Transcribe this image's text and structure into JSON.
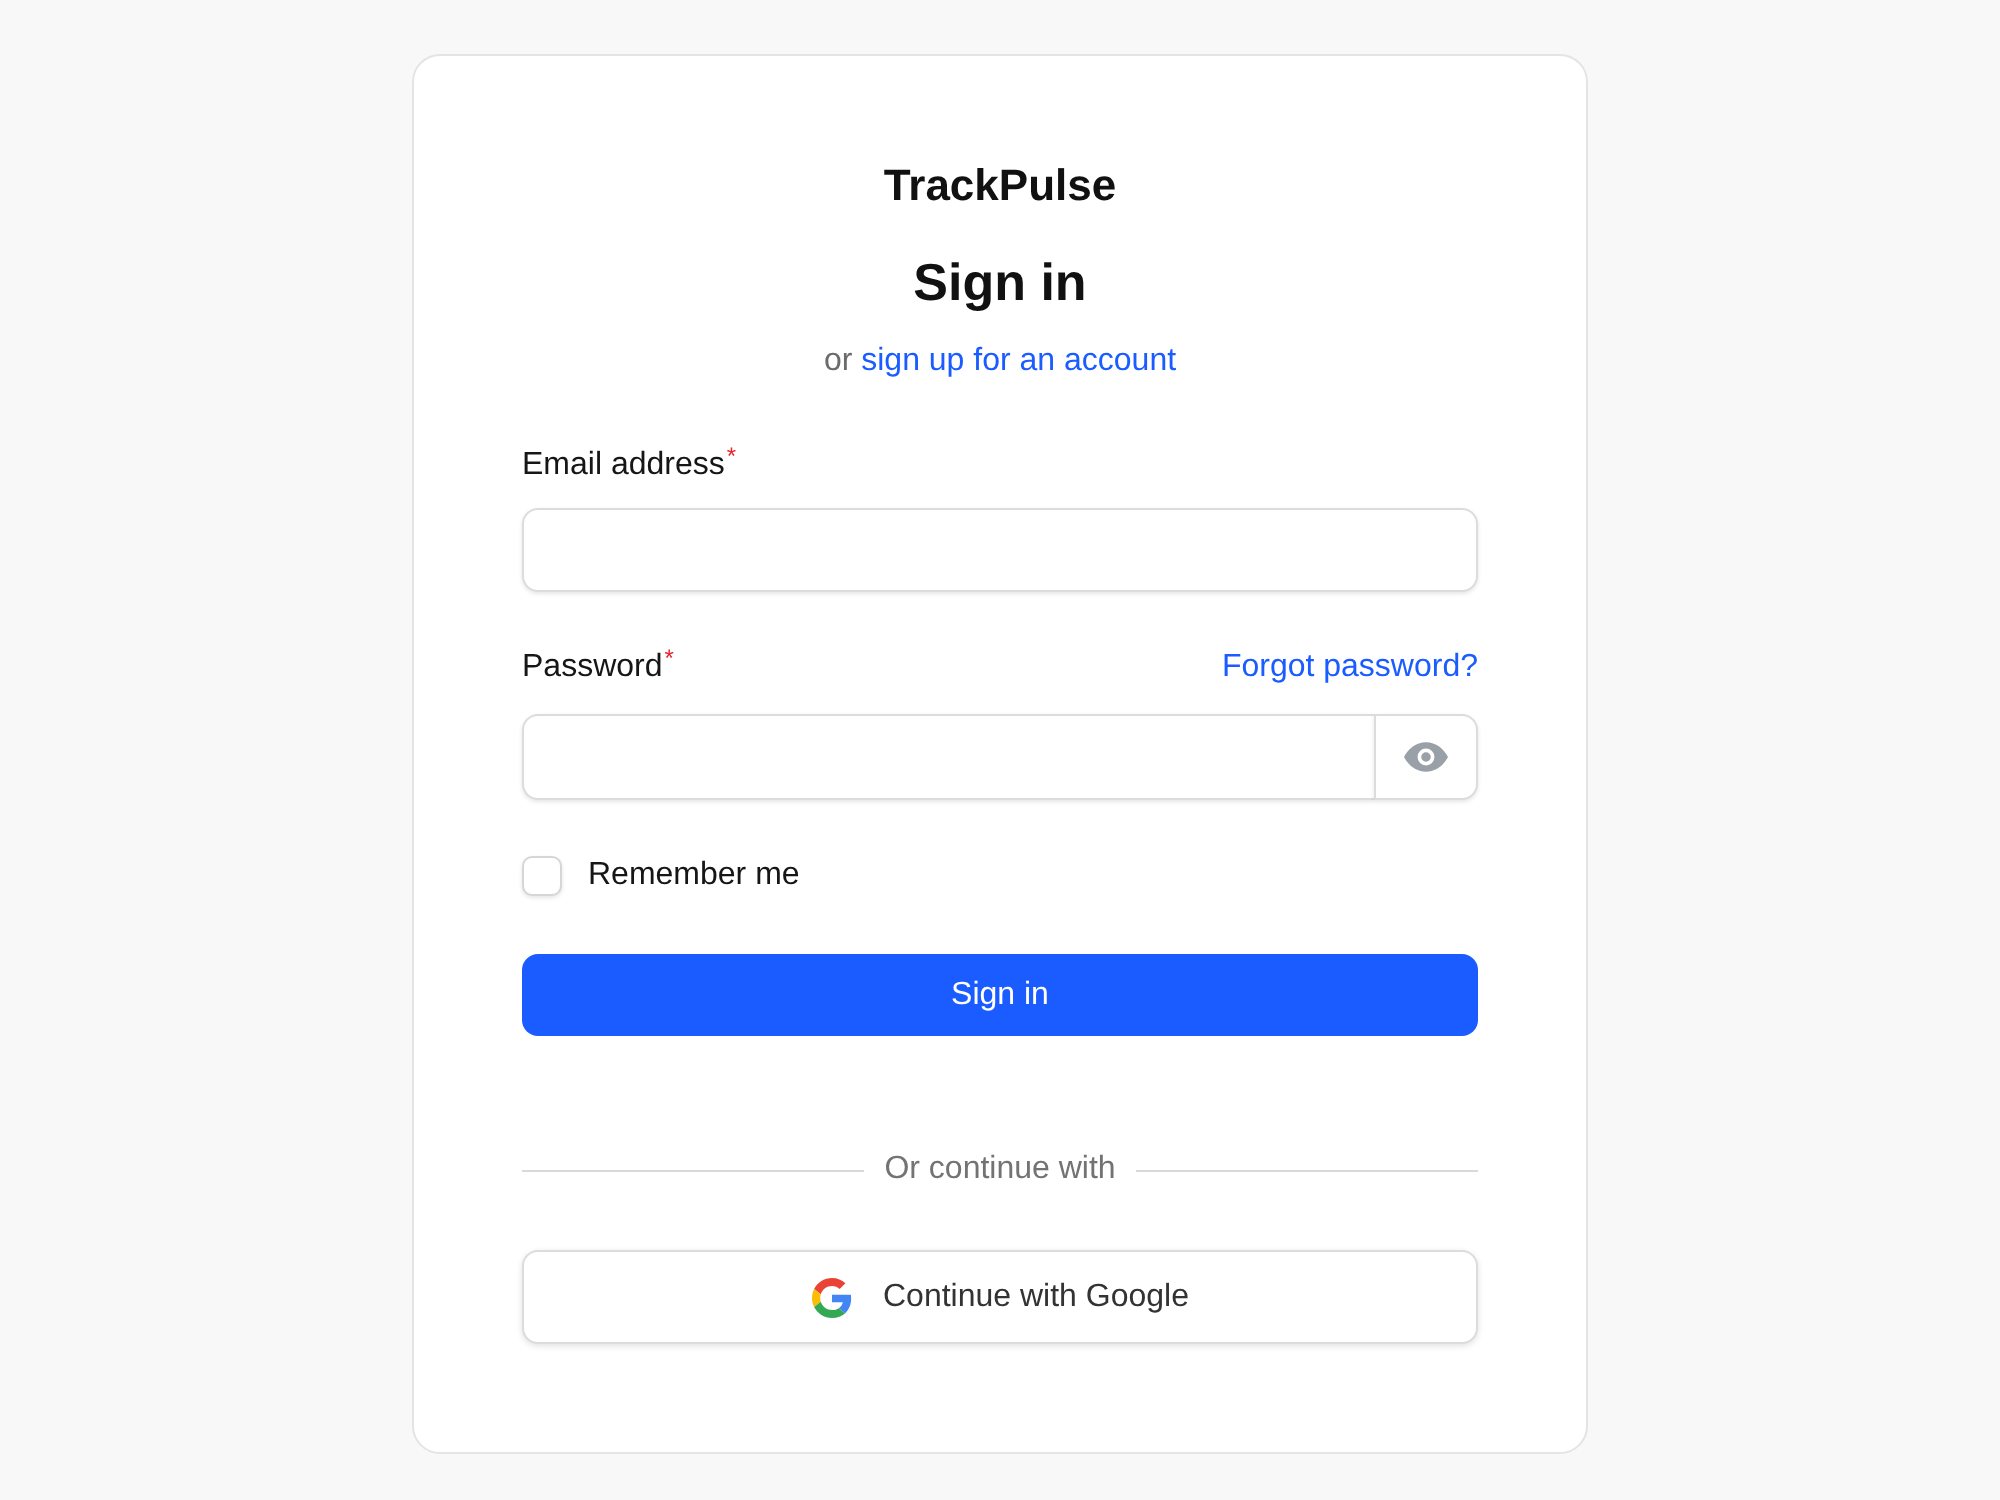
{
  "brand": {
    "name": "TrackPulse"
  },
  "heading": "Sign in",
  "signup_prompt": {
    "text": "or",
    "link": "sign up for an account"
  },
  "fields": [
    {
      "kind": "email",
      "label": "Email address",
      "required_mark": "*"
    },
    {
      "kind": "password",
      "label": "Password",
      "required_mark": "*",
      "link": "Forgot password?"
    }
  ],
  "remember": {
    "label": "Remember me",
    "checked": false
  },
  "submit_button": "Sign in",
  "divider": "Or continue with",
  "social_buttons": [
    {
      "kind": "google",
      "label": "Continue with Google"
    }
  ]
}
